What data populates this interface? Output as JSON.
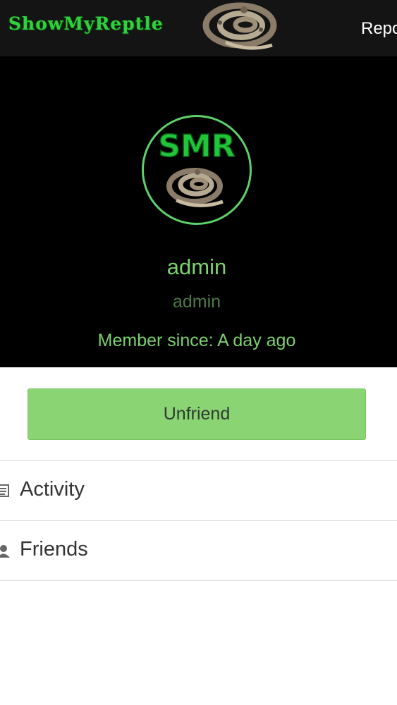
{
  "header": {
    "logo_text": "ShowMyReptle",
    "nav_link": "Repo"
  },
  "profile": {
    "avatar_text": "SMR",
    "display_name": "admin",
    "username": "admin",
    "member_since": "Member since: A day ago"
  },
  "actions": {
    "unfriend_label": "Unfriend"
  },
  "menu": {
    "items": [
      {
        "label": "Activity",
        "icon": "activity-list-icon"
      },
      {
        "label": "Friends",
        "icon": "friends-user-icon"
      }
    ]
  },
  "colors": {
    "brand_green": "#2fd23c",
    "accent_green": "#7bd26d",
    "button_green": "#8ad474",
    "hero_background": "#000000",
    "topbar_background": "#141414"
  }
}
